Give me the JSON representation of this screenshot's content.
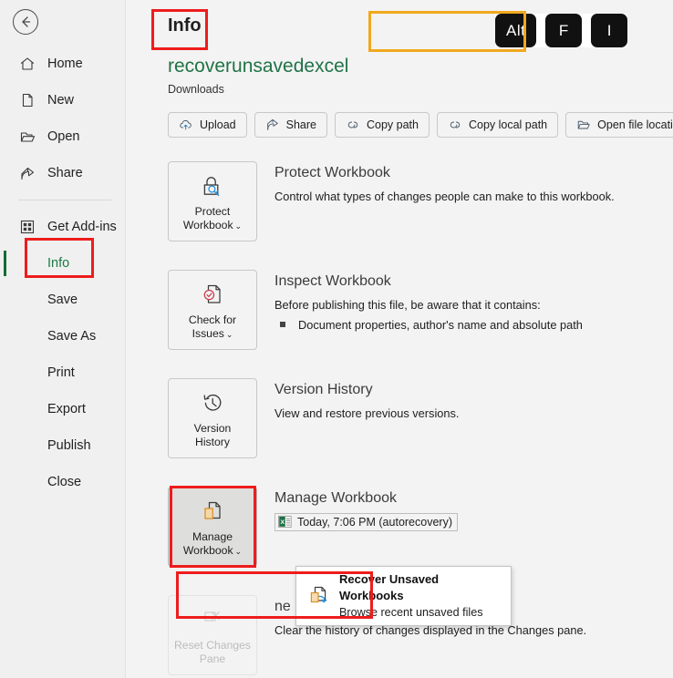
{
  "window": {
    "title": "Info"
  },
  "sidebar": {
    "back_label": "Back",
    "items": [
      {
        "label": "Home",
        "icon": "home-icon"
      },
      {
        "label": "New",
        "icon": "new-document-icon"
      },
      {
        "label": "Open",
        "icon": "open-folder-icon"
      },
      {
        "label": "Share",
        "icon": "share-icon"
      },
      {
        "label": "Get Add-ins",
        "icon": "grid-addins-icon"
      },
      {
        "label": "Info",
        "icon": "none"
      },
      {
        "label": "Save",
        "icon": "none"
      },
      {
        "label": "Save As",
        "icon": "none"
      },
      {
        "label": "Print",
        "icon": "none"
      },
      {
        "label": "Export",
        "icon": "none"
      },
      {
        "label": "Publish",
        "icon": "none"
      },
      {
        "label": "Close",
        "icon": "none"
      }
    ],
    "active_item": "Info",
    "accent_color": "#136b38"
  },
  "header": {
    "page_title": "Info",
    "file_name": "recoverunsavedexcel",
    "file_location": "Downloads",
    "file_name_color": "#217346",
    "keyboard_shortcut": [
      "Alt",
      "F",
      "I"
    ]
  },
  "toolbar": {
    "buttons": [
      {
        "label": "Upload",
        "icon": "cloud-upload-icon"
      },
      {
        "label": "Share",
        "icon": "share-arrow-icon"
      },
      {
        "label": "Copy path",
        "icon": "link-icon"
      },
      {
        "label": "Copy local path",
        "icon": "link-icon"
      },
      {
        "label": "Open file location",
        "icon": "folder-open-icon"
      }
    ]
  },
  "sections": {
    "protect": {
      "button_label_line1": "Protect",
      "button_label_line2": "Workbook",
      "button_icon": "lock-key-icon",
      "title": "Protect Workbook",
      "description": "Control what types of changes people can make to this workbook."
    },
    "inspect": {
      "button_label_line1": "Check for",
      "button_label_line2": "Issues",
      "button_icon": "document-check-icon",
      "title": "Inspect Workbook",
      "description": "Before publishing this file, be aware that it contains:",
      "bullet": "Document properties, author's name and absolute path"
    },
    "version": {
      "button_label_line1": "Version",
      "button_label_line2": "History",
      "button_icon": "clock-history-icon",
      "title": "Version History",
      "description": "View and restore previous versions."
    },
    "manage": {
      "button_label_line1": "Manage",
      "button_label_line2": "Workbook",
      "button_icon": "manage-workbook-icon",
      "title": "Manage Workbook",
      "autorecovery_entry": "Today, 7:06 PM (autorecovery)",
      "autorecovery_icon": "excel-file-icon"
    },
    "reset": {
      "button_label_line1": "Reset Changes",
      "button_label_line2": "Pane",
      "button_icon": "reset-pane-icon",
      "title": "ne",
      "description": "Clear the history of changes displayed in the Changes pane.",
      "disabled": true
    }
  },
  "dropdown": {
    "item_title": "Recover Unsaved Workbooks",
    "item_subtitle": "Browse recent unsaved files",
    "item_icon": "recover-unsaved-icon"
  },
  "annotations": {
    "highlight_color": "#ee1c1c",
    "shortcut_box_color": "#f0a81e"
  }
}
